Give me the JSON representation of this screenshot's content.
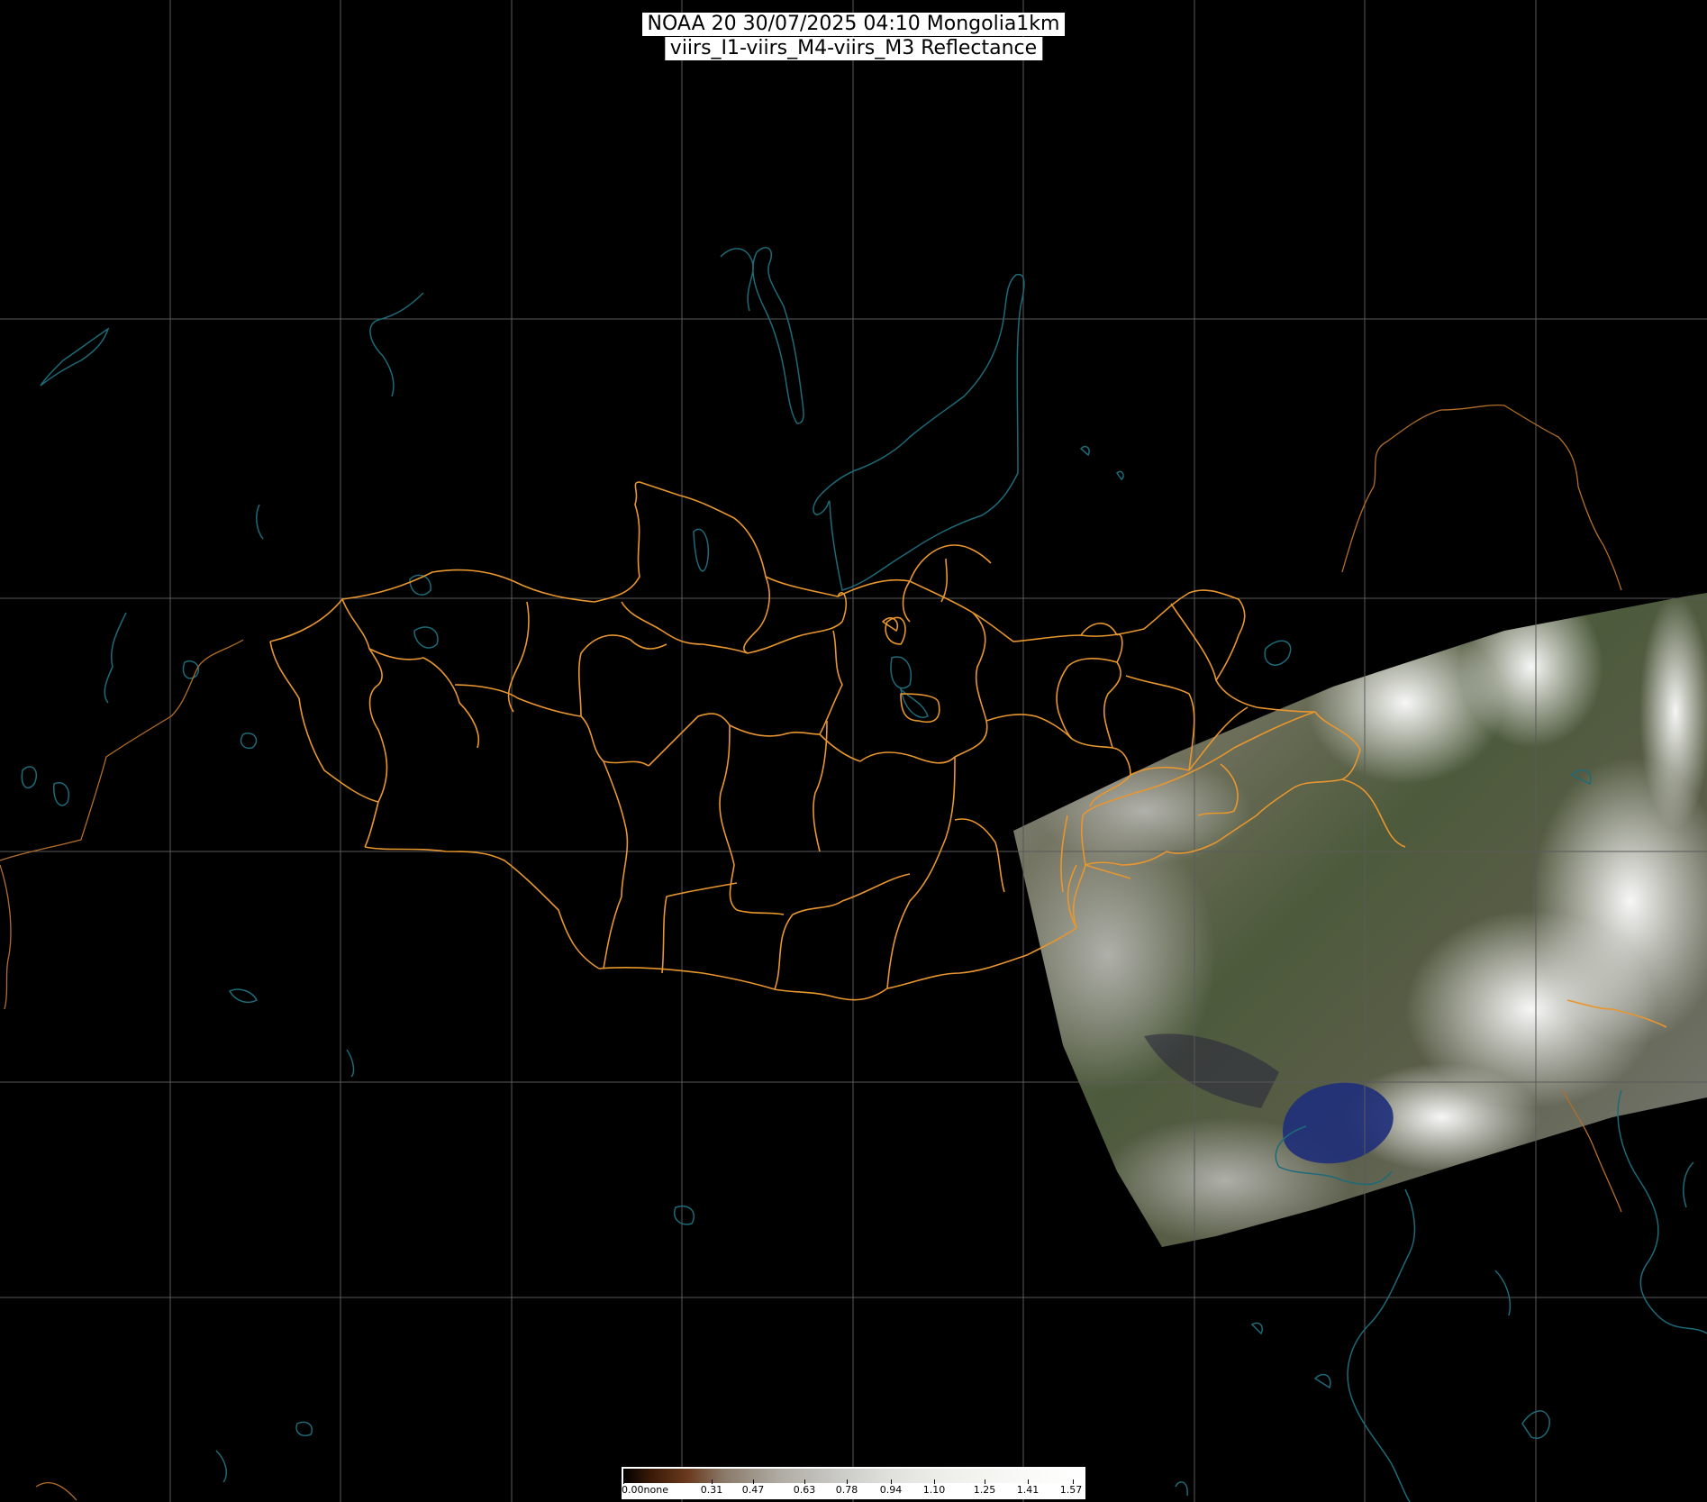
{
  "header": {
    "line1": "NOAA 20 30/07/2025 04:10 Mongolia1km",
    "line2": "viirs_I1-viirs_M4-viirs_M3 Reflectance"
  },
  "colorbar": {
    "labels": [
      "0.00none",
      "0.31",
      "0.47",
      "0.63",
      "0.78",
      "0.94",
      "1.10",
      "1.25",
      "1.41",
      "1.57"
    ]
  },
  "colors": {
    "grid": "#5a5a5a",
    "coastline": "#1e6a78",
    "province_border": "#e8962e",
    "country_border": "#b36e2a"
  }
}
